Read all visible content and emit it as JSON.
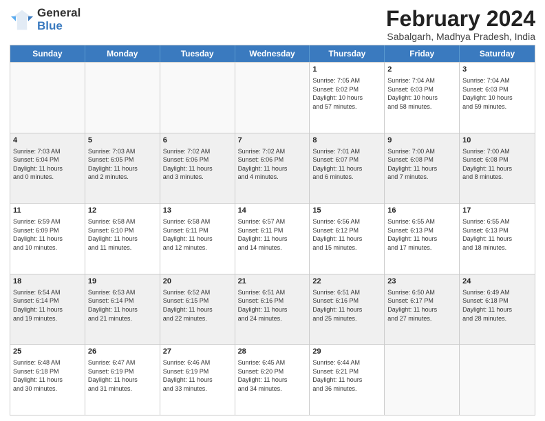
{
  "logo": {
    "line1": "General",
    "line2": "Blue"
  },
  "title": "February 2024",
  "subtitle": "Sabalgarh, Madhya Pradesh, India",
  "weekdays": [
    "Sunday",
    "Monday",
    "Tuesday",
    "Wednesday",
    "Thursday",
    "Friday",
    "Saturday"
  ],
  "weeks": [
    [
      {
        "day": "",
        "info": "",
        "empty": true
      },
      {
        "day": "",
        "info": "",
        "empty": true
      },
      {
        "day": "",
        "info": "",
        "empty": true
      },
      {
        "day": "",
        "info": "",
        "empty": true
      },
      {
        "day": "1",
        "info": "Sunrise: 7:05 AM\nSunset: 6:02 PM\nDaylight: 10 hours\nand 57 minutes."
      },
      {
        "day": "2",
        "info": "Sunrise: 7:04 AM\nSunset: 6:03 PM\nDaylight: 10 hours\nand 58 minutes."
      },
      {
        "day": "3",
        "info": "Sunrise: 7:04 AM\nSunset: 6:03 PM\nDaylight: 10 hours\nand 59 minutes."
      }
    ],
    [
      {
        "day": "4",
        "info": "Sunrise: 7:03 AM\nSunset: 6:04 PM\nDaylight: 11 hours\nand 0 minutes.",
        "shaded": true
      },
      {
        "day": "5",
        "info": "Sunrise: 7:03 AM\nSunset: 6:05 PM\nDaylight: 11 hours\nand 2 minutes.",
        "shaded": true
      },
      {
        "day": "6",
        "info": "Sunrise: 7:02 AM\nSunset: 6:06 PM\nDaylight: 11 hours\nand 3 minutes.",
        "shaded": true
      },
      {
        "day": "7",
        "info": "Sunrise: 7:02 AM\nSunset: 6:06 PM\nDaylight: 11 hours\nand 4 minutes.",
        "shaded": true
      },
      {
        "day": "8",
        "info": "Sunrise: 7:01 AM\nSunset: 6:07 PM\nDaylight: 11 hours\nand 6 minutes.",
        "shaded": true
      },
      {
        "day": "9",
        "info": "Sunrise: 7:00 AM\nSunset: 6:08 PM\nDaylight: 11 hours\nand 7 minutes.",
        "shaded": true
      },
      {
        "day": "10",
        "info": "Sunrise: 7:00 AM\nSunset: 6:08 PM\nDaylight: 11 hours\nand 8 minutes.",
        "shaded": true
      }
    ],
    [
      {
        "day": "11",
        "info": "Sunrise: 6:59 AM\nSunset: 6:09 PM\nDaylight: 11 hours\nand 10 minutes."
      },
      {
        "day": "12",
        "info": "Sunrise: 6:58 AM\nSunset: 6:10 PM\nDaylight: 11 hours\nand 11 minutes."
      },
      {
        "day": "13",
        "info": "Sunrise: 6:58 AM\nSunset: 6:11 PM\nDaylight: 11 hours\nand 12 minutes."
      },
      {
        "day": "14",
        "info": "Sunrise: 6:57 AM\nSunset: 6:11 PM\nDaylight: 11 hours\nand 14 minutes."
      },
      {
        "day": "15",
        "info": "Sunrise: 6:56 AM\nSunset: 6:12 PM\nDaylight: 11 hours\nand 15 minutes."
      },
      {
        "day": "16",
        "info": "Sunrise: 6:55 AM\nSunset: 6:13 PM\nDaylight: 11 hours\nand 17 minutes."
      },
      {
        "day": "17",
        "info": "Sunrise: 6:55 AM\nSunset: 6:13 PM\nDaylight: 11 hours\nand 18 minutes."
      }
    ],
    [
      {
        "day": "18",
        "info": "Sunrise: 6:54 AM\nSunset: 6:14 PM\nDaylight: 11 hours\nand 19 minutes.",
        "shaded": true
      },
      {
        "day": "19",
        "info": "Sunrise: 6:53 AM\nSunset: 6:14 PM\nDaylight: 11 hours\nand 21 minutes.",
        "shaded": true
      },
      {
        "day": "20",
        "info": "Sunrise: 6:52 AM\nSunset: 6:15 PM\nDaylight: 11 hours\nand 22 minutes.",
        "shaded": true
      },
      {
        "day": "21",
        "info": "Sunrise: 6:51 AM\nSunset: 6:16 PM\nDaylight: 11 hours\nand 24 minutes.",
        "shaded": true
      },
      {
        "day": "22",
        "info": "Sunrise: 6:51 AM\nSunset: 6:16 PM\nDaylight: 11 hours\nand 25 minutes.",
        "shaded": true
      },
      {
        "day": "23",
        "info": "Sunrise: 6:50 AM\nSunset: 6:17 PM\nDaylight: 11 hours\nand 27 minutes.",
        "shaded": true
      },
      {
        "day": "24",
        "info": "Sunrise: 6:49 AM\nSunset: 6:18 PM\nDaylight: 11 hours\nand 28 minutes.",
        "shaded": true
      }
    ],
    [
      {
        "day": "25",
        "info": "Sunrise: 6:48 AM\nSunset: 6:18 PM\nDaylight: 11 hours\nand 30 minutes."
      },
      {
        "day": "26",
        "info": "Sunrise: 6:47 AM\nSunset: 6:19 PM\nDaylight: 11 hours\nand 31 minutes."
      },
      {
        "day": "27",
        "info": "Sunrise: 6:46 AM\nSunset: 6:19 PM\nDaylight: 11 hours\nand 33 minutes."
      },
      {
        "day": "28",
        "info": "Sunrise: 6:45 AM\nSunset: 6:20 PM\nDaylight: 11 hours\nand 34 minutes."
      },
      {
        "day": "29",
        "info": "Sunrise: 6:44 AM\nSunset: 6:21 PM\nDaylight: 11 hours\nand 36 minutes."
      },
      {
        "day": "",
        "info": "",
        "empty": true
      },
      {
        "day": "",
        "info": "",
        "empty": true
      }
    ]
  ]
}
